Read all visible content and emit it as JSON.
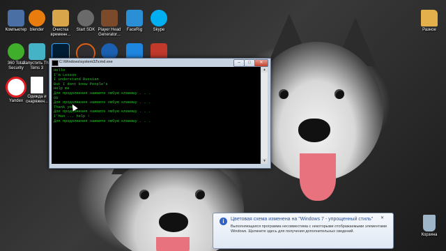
{
  "desktop": {
    "icons": [
      {
        "label": "Компьютер",
        "name": "computer-icon",
        "color": "#4a6fa5"
      },
      {
        "label": "blender",
        "name": "blender-icon",
        "color": "#e87d0d"
      },
      {
        "label": "Очистка временн...",
        "name": "broom-icon",
        "color": "#d8a54a"
      },
      {
        "label": "Start SDK",
        "name": "sdk-icon",
        "color": "#6a6a6a"
      },
      {
        "label": "Player Head Generator...",
        "name": "player-head-icon",
        "color": "#7a4a2a"
      },
      {
        "label": "FaceRig",
        "name": "facerig-icon",
        "color": "#2a8fd4"
      },
      {
        "label": "Skype",
        "name": "skype-icon",
        "color": "#00aff0"
      },
      {
        "label": "360 Total Security",
        "name": "security-plus-icon",
        "color": "#3fae2a"
      },
      {
        "label": "Запустить The Sims 3",
        "name": "sims-icon",
        "color": "#44b3c6"
      },
      {
        "label": "",
        "name": "photoshop-icon",
        "color": "#001d34"
      },
      {
        "label": "",
        "name": "obs-icon",
        "color": "#302e31"
      },
      {
        "label": "",
        "name": "cinema4d-icon",
        "color": "#1b5fb0"
      },
      {
        "label": "",
        "name": "app-blue-icon",
        "color": "#1f86e0"
      },
      {
        "label": "",
        "name": "app-red-icon",
        "color": "#c0392b"
      },
      {
        "label": "Yandex",
        "name": "yandex-icon",
        "color": "#e11b22"
      },
      {
        "label": "Одежда и снаряжен...",
        "name": "document-icon",
        "color": "#ffffff"
      },
      {
        "label": "Разное",
        "name": "folder-icon",
        "color": "#e3b04b"
      },
      {
        "label": "Корзина",
        "name": "recycle-bin-icon",
        "color": "#9fb6c9"
      }
    ]
  },
  "cmd": {
    "title": "C:\\Windows\\system32\\cmd.exe",
    "buttons": {
      "minimize": "–",
      "maximize": "□",
      "close": "✕"
    },
    "lines": [
      "Hello",
      "I'm Lesson",
      "I understand Russian",
      "But I dont know People's",
      "Help me",
      "Для продолжения нажмите любую клавишу . . .",
      "Ok",
      "Для продолжения нажмите любую клавишу . . .",
      "Thank you",
      "Для продолжения нажмите любую клавишу . . .",
      "I'Man ... help !",
      "Для продолжения нажмите любую клавишу . . ."
    ]
  },
  "notification": {
    "title": "Цветовая схема изменена на \"Windows 7 - упрощенный стиль\"",
    "body": "Выполняющаяся программа несовместима с некоторыми отображаемыми элементами Windows. Щелкните здесь для получения дополнительных сведений.",
    "close": "✕"
  },
  "colors": {
    "console_text": "#21c821",
    "console_bg": "#000000",
    "notif_title": "#2a4f95"
  }
}
